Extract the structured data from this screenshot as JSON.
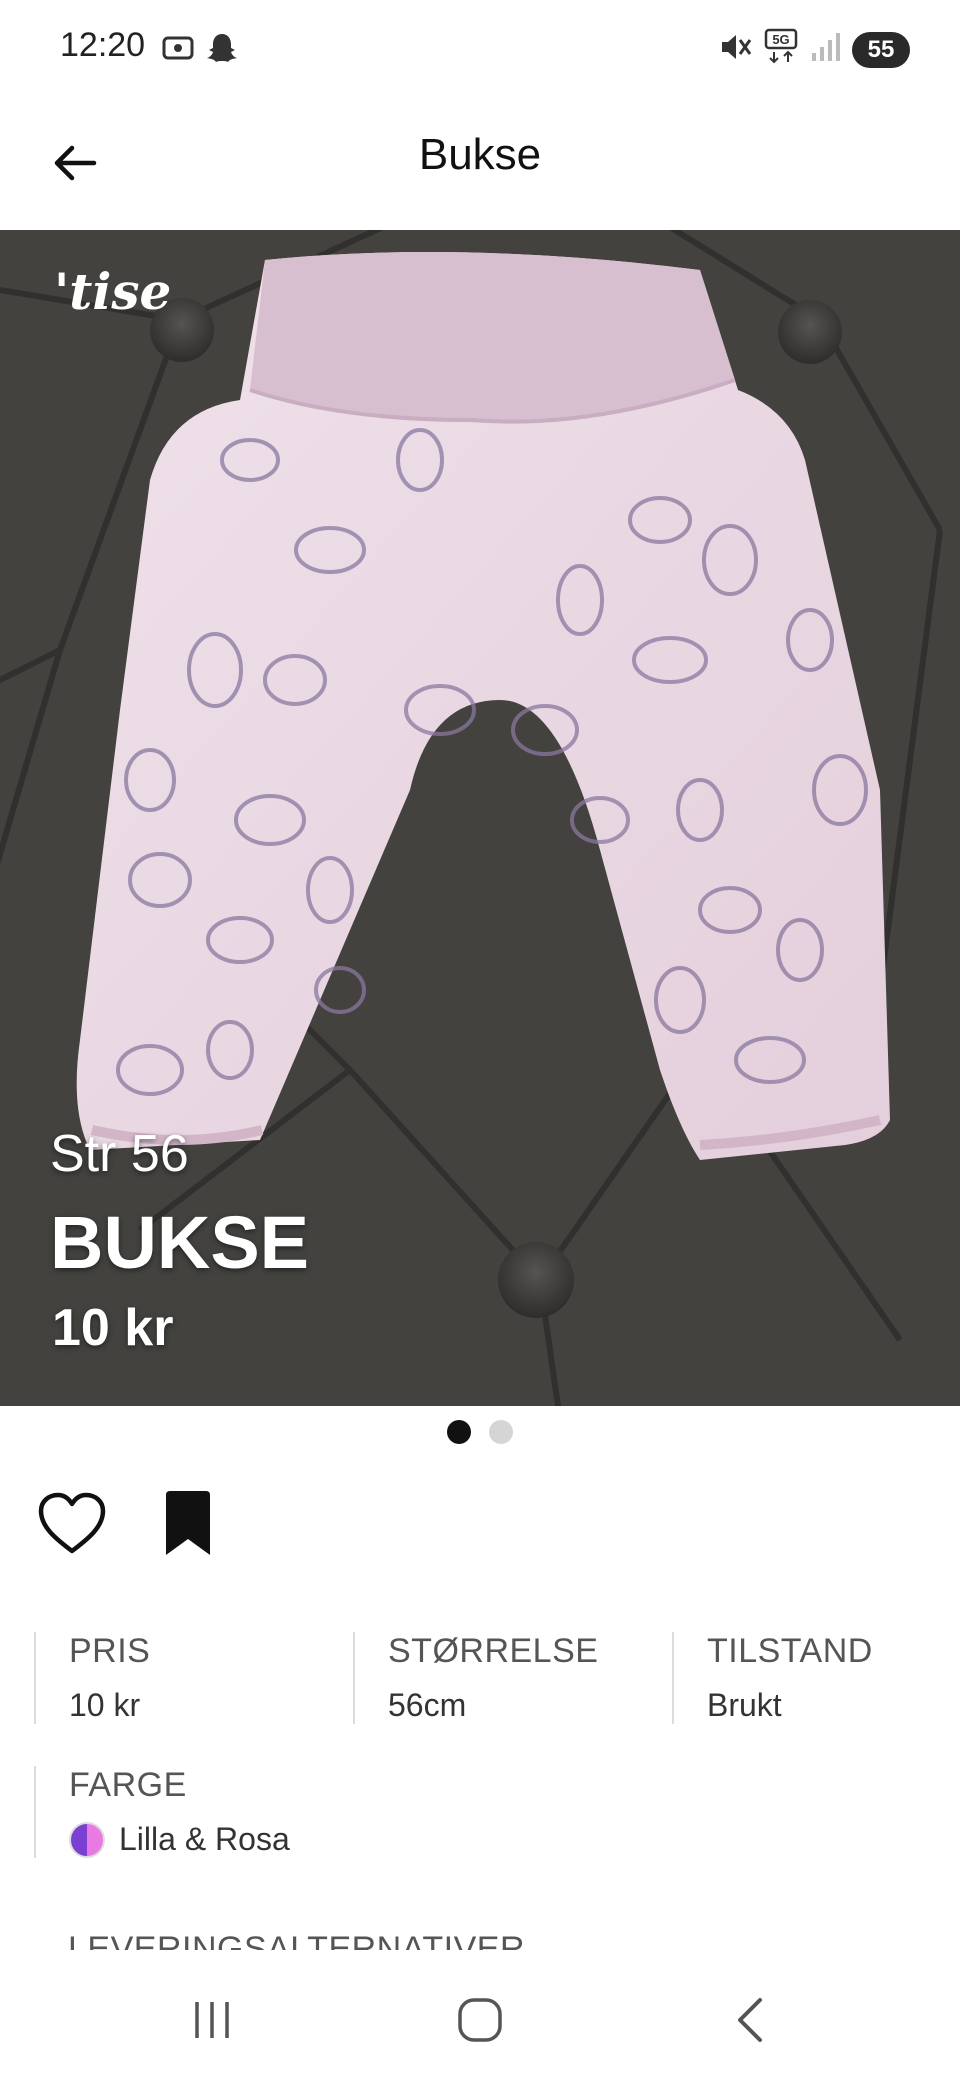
{
  "status_bar": {
    "time": "12:20",
    "network": "5G",
    "battery": "55",
    "icons": [
      "screenshot-icon",
      "snapchat-icon",
      "mute-icon",
      "signal-icon"
    ]
  },
  "header": {
    "title": "Bukse",
    "back_icon": "back-arrow-icon"
  },
  "hero": {
    "brand": "'tise",
    "size_text": "Str 56",
    "title": "BUKSE",
    "price": "10 kr",
    "page_count": 2,
    "active_page": 1
  },
  "actions": {
    "like_icon": "heart-icon",
    "save_icon": "bookmark-icon"
  },
  "details": {
    "price": {
      "label": "PRIS",
      "value": "10 kr"
    },
    "size": {
      "label": "STØRRELSE",
      "value": "56cm"
    },
    "condition": {
      "label": "TILSTAND",
      "value": "Brukt"
    },
    "color": {
      "label": "FARGE",
      "value": "Lilla & Rosa",
      "swatch_colors": [
        "#7b3fd1",
        "#e97ae4"
      ]
    }
  },
  "delivery": {
    "label": "LEVERINGSALTERNATIVER"
  },
  "nav_bar": {
    "icons": [
      "recent-apps-icon",
      "home-icon",
      "back-icon"
    ]
  }
}
